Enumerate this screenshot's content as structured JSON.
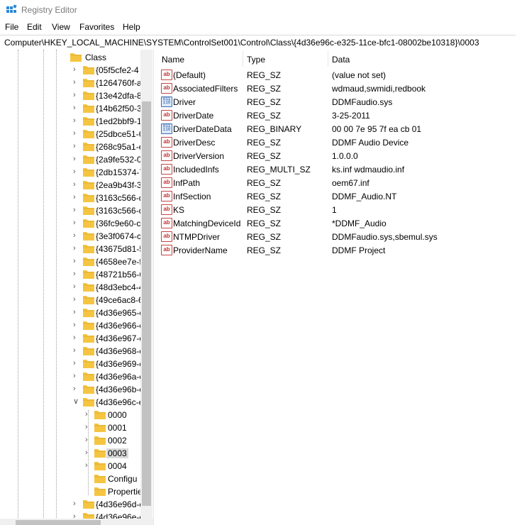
{
  "window": {
    "title": "Registry Editor"
  },
  "menu": {
    "file": "File",
    "edit": "Edit",
    "view": "View",
    "favorites": "Favorites",
    "help": "Help"
  },
  "address": {
    "path": "Computer\\HKEY_LOCAL_MACHINE\\SYSTEM\\ControlSet001\\Control\\Class\\{4d36e96c-e325-11ce-bfc1-08002be10318}\\0003"
  },
  "tree": {
    "class_label": "Class",
    "keys": [
      "{05f5cfe2-4",
      "{1264760f-a",
      "{13e42dfa-8",
      "{14b62f50-3",
      "{1ed2bbf9-1",
      "{25dbce51-6",
      "{268c95a1-e",
      "{2a9fe532-0",
      "{2db15374-7",
      "{2ea9b43f-3",
      "{3163c566-d",
      "{3163c566-d",
      "{36fc9e60-c",
      "{3e3f0674-c",
      "{43675d81-5",
      "{4658ee7e-f",
      "{48721b56-6",
      "{48d3ebc4-4",
      "{49ce6ac8-6",
      "{4d36e965-e",
      "{4d36e966-e",
      "{4d36e967-e",
      "{4d36e968-e",
      "{4d36e969-e",
      "{4d36e96a-e",
      "{4d36e96b-e",
      "{4d36e96c-e"
    ],
    "children": [
      "0000",
      "0001",
      "0002",
      "0003",
      "0004",
      "Configu",
      "Propertie"
    ],
    "after": [
      "{4d36e96d-e",
      "{4d36e96e-e"
    ]
  },
  "list": {
    "headers": {
      "name": "Name",
      "type": "Type",
      "data": "Data"
    },
    "rows": [
      {
        "icon": "string-value-icon",
        "name": "(Default)",
        "type": "REG_SZ",
        "data": "(value not set)"
      },
      {
        "icon": "string-value-icon",
        "name": "AssociatedFilters",
        "type": "REG_SZ",
        "data": "wdmaud,swmidi,redbook"
      },
      {
        "icon": "binary-value-icon",
        "name": "Driver",
        "type": "REG_SZ",
        "data": "DDMFaudio.sys"
      },
      {
        "icon": "string-value-icon",
        "name": "DriverDate",
        "type": "REG_SZ",
        "data": "3-25-2011"
      },
      {
        "icon": "binary-value-icon",
        "name": "DriverDateData",
        "type": "REG_BINARY",
        "data": "00 00 7e 95 7f ea cb 01"
      },
      {
        "icon": "string-value-icon",
        "name": "DriverDesc",
        "type": "REG_SZ",
        "data": "DDMF Audio Device"
      },
      {
        "icon": "string-value-icon",
        "name": "DriverVersion",
        "type": "REG_SZ",
        "data": "1.0.0.0"
      },
      {
        "icon": "string-value-icon",
        "name": "IncludedInfs",
        "type": "REG_MULTI_SZ",
        "data": "ks.inf wdmaudio.inf"
      },
      {
        "icon": "string-value-icon",
        "name": "InfPath",
        "type": "REG_SZ",
        "data": "oem67.inf"
      },
      {
        "icon": "string-value-icon",
        "name": "InfSection",
        "type": "REG_SZ",
        "data": "DDMF_Audio.NT"
      },
      {
        "icon": "string-value-icon",
        "name": "KS",
        "type": "REG_SZ",
        "data": "1"
      },
      {
        "icon": "string-value-icon",
        "name": "MatchingDeviceId",
        "type": "REG_SZ",
        "data": "*DDMF_Audio"
      },
      {
        "icon": "string-value-icon",
        "name": "NTMPDriver",
        "type": "REG_SZ",
        "data": "DDMFaudio.sys,sbemul.sys"
      },
      {
        "icon": "string-value-icon",
        "name": "ProviderName",
        "type": "REG_SZ",
        "data": "DDMF Project"
      }
    ]
  },
  "icons": {
    "sz_glyph": "ab",
    "bin_glyph": "011 110"
  },
  "colors": {
    "folder": "#f5c542",
    "selection": "#d9d9d9",
    "sz_icon": "#c03030",
    "bin_icon": "#2a5aa0"
  }
}
